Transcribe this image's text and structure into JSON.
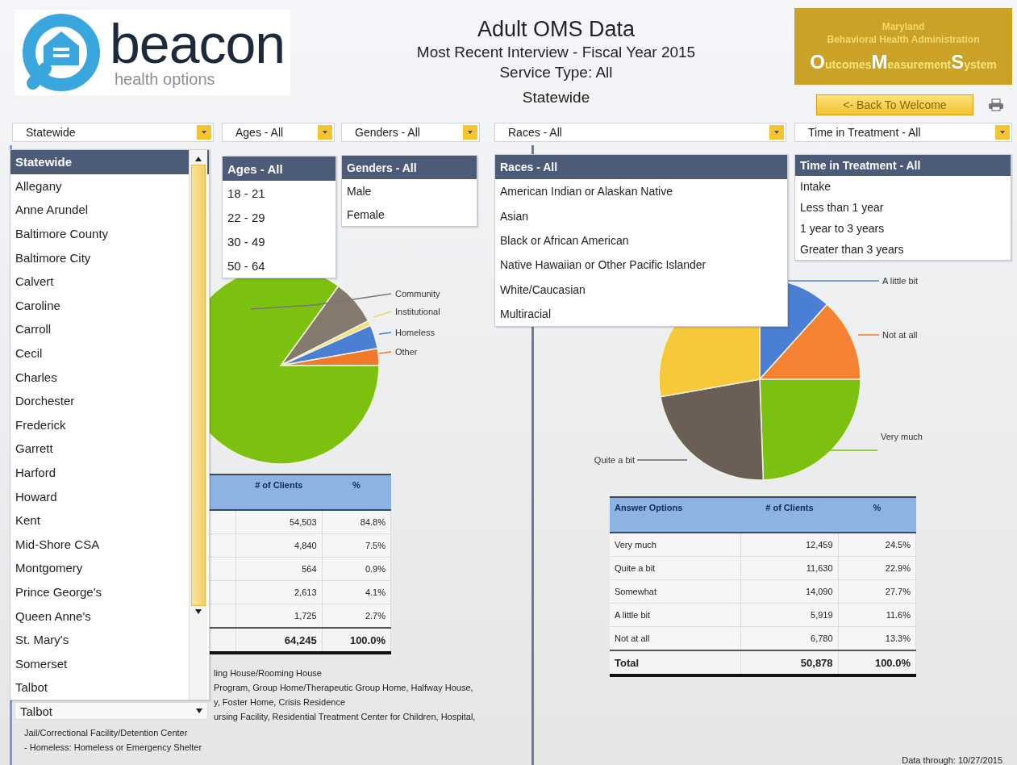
{
  "logo": {
    "name": "beacon",
    "tagline": "health options"
  },
  "header": {
    "title": "Adult OMS Data",
    "subtitle": "Most Recent Interview - Fiscal Year 2015",
    "service_type": "Service Type: All",
    "region": "Statewide"
  },
  "badge": {
    "state": "Maryland",
    "agency": "Behavioral Health Administration",
    "system_words": [
      "Outcomes",
      "Measurement",
      "System"
    ]
  },
  "back_button": "<- Back To Welcome",
  "filters": [
    {
      "value": "Statewide"
    },
    {
      "value": "Ages - All"
    },
    {
      "value": "Genders - All"
    },
    {
      "value": "Races - All"
    },
    {
      "value": "Time in Treatment - All"
    }
  ],
  "dropdowns": [
    {
      "items": [
        {
          "label": "Statewide",
          "selected": true
        },
        {
          "label": "Allegany",
          "selected": false
        },
        {
          "label": "Anne Arundel",
          "selected": false
        },
        {
          "label": "Baltimore County",
          "selected": false
        },
        {
          "label": "Baltimore City",
          "selected": false
        },
        {
          "label": "Calvert",
          "selected": false
        },
        {
          "label": "Caroline",
          "selected": false
        },
        {
          "label": "Carroll",
          "selected": false
        },
        {
          "label": "Cecil",
          "selected": false
        },
        {
          "label": "Charles",
          "selected": false
        },
        {
          "label": "Dorchester",
          "selected": false
        },
        {
          "label": "Frederick",
          "selected": false
        },
        {
          "label": "Garrett",
          "selected": false
        },
        {
          "label": "Harford",
          "selected": false
        },
        {
          "label": "Howard",
          "selected": false
        },
        {
          "label": "Kent",
          "selected": false
        },
        {
          "label": "Mid-Shore CSA",
          "selected": false
        },
        {
          "label": "Montgomery",
          "selected": false
        },
        {
          "label": "Prince George's",
          "selected": false
        },
        {
          "label": "Queen Anne's",
          "selected": false
        },
        {
          "label": "St. Mary's",
          "selected": false
        },
        {
          "label": "Somerset",
          "selected": false
        },
        {
          "label": "Talbot",
          "selected": false
        }
      ]
    },
    {
      "items": [
        {
          "label": "Ages - All",
          "selected": true
        },
        {
          "label": "18 - 21",
          "selected": false
        },
        {
          "label": "22 - 29",
          "selected": false
        },
        {
          "label": "30 - 49",
          "selected": false
        },
        {
          "label": "50 - 64",
          "selected": false
        }
      ]
    },
    {
      "items": [
        {
          "label": "Genders - All",
          "selected": true
        },
        {
          "label": "Male",
          "selected": false
        },
        {
          "label": "Female",
          "selected": false
        }
      ]
    },
    {
      "items": [
        {
          "label": "Races - All",
          "selected": true
        },
        {
          "label": "American Indian or Alaskan Native",
          "selected": false
        },
        {
          "label": "Asian",
          "selected": false
        },
        {
          "label": "Black or African American",
          "selected": false
        },
        {
          "label": "Native Hawaiian or Other Pacific Islander",
          "selected": false
        },
        {
          "label": "White/Caucasian",
          "selected": false
        },
        {
          "label": "Multiracial",
          "selected": false
        }
      ]
    },
    {
      "items": [
        {
          "label": "Time in Treatment - All",
          "selected": true
        },
        {
          "label": "Intake",
          "selected": false
        },
        {
          "label": "Less than 1 year",
          "selected": false
        },
        {
          "label": "1 year to 3 years",
          "selected": false
        },
        {
          "label": "Greater than 3 years",
          "selected": false
        }
      ]
    }
  ],
  "extra_select": "Talbot",
  "left": {
    "chart_labels": [
      "Community",
      "Institutional",
      "Homeless",
      "Other"
    ],
    "table": {
      "columns": [
        "# of Clients",
        "%"
      ],
      "rows": [
        [
          "54,503",
          "84.8%"
        ],
        [
          "4,840",
          "7.5%"
        ],
        [
          "564",
          "0.9%"
        ],
        [
          "2,613",
          "4.1%"
        ],
        [
          "1,725",
          "2.7%"
        ]
      ],
      "total": [
        "64,245",
        "100.0%"
      ]
    },
    "notes": [
      "ling House/Rooming House",
      "Program, Group Home/Therapeutic Group Home, Halfway House,",
      "y, Foster Home, Crisis Residence",
      "ursing Facility, Residential Treatment Center for Children, Hospital,"
    ],
    "notes_after": [
      "Jail/Correctional Facility/Detention Center",
      "- Homeless: Homeless or Emergency Shelter"
    ]
  },
  "right": {
    "chart_labels": [
      "A little bit",
      "Not at all",
      "Very much",
      "Quite a bit"
    ],
    "table": {
      "columns": [
        "Answer Options",
        "# of Clients",
        "%"
      ],
      "rows": [
        [
          "Very much",
          "12,459",
          "24.5%"
        ],
        [
          "Quite a bit",
          "11,630",
          "22.9%"
        ],
        [
          "Somewhat",
          "14,090",
          "27.7%"
        ],
        [
          "A little bit",
          "5,919",
          "11.6%"
        ],
        [
          "Not at all",
          "6,780",
          "13.3%"
        ]
      ],
      "total": [
        "Total",
        "50,878",
        "100.0%"
      ]
    }
  },
  "footer": "Data through: 10/27/2015"
}
